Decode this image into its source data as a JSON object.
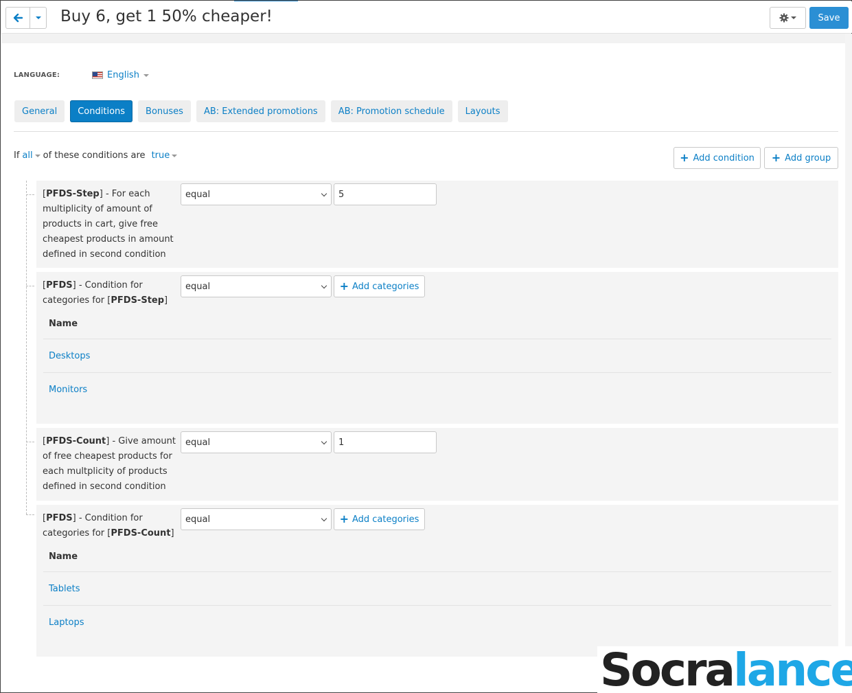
{
  "header": {
    "back_icon": "arrow-left-icon",
    "title": "Buy 6, get 1 50% cheaper!",
    "settings_icon": "gear-icon",
    "save_label": "Save"
  },
  "language": {
    "label": "LANGUAGE:",
    "value": "English"
  },
  "tabs": [
    {
      "label": "General",
      "active": false
    },
    {
      "label": "Conditions",
      "active": true
    },
    {
      "label": "Bonuses",
      "active": false
    },
    {
      "label": "AB: Extended promotions",
      "active": false
    },
    {
      "label": "AB: Promotion schedule",
      "active": false
    },
    {
      "label": "Layouts",
      "active": false
    }
  ],
  "conditions_header": {
    "if": "If",
    "all": "all",
    "of_these": "of these conditions are",
    "value": "true",
    "add_condition": "Add condition",
    "add_group": "Add group"
  },
  "conditions": [
    {
      "code": "PFDS-Step",
      "desc": " - For each multiplicity of amount of products in cart, give free cheapest products in amount defined in second condition",
      "operator": "equal",
      "value": "5"
    },
    {
      "code": "PFDS",
      "desc": " - Condition for categories for ",
      "ref": "PFDS-Step",
      "operator": "equal",
      "add_label": "Add categories",
      "table_header": "Name",
      "categories": [
        "Desktops",
        "Monitors"
      ]
    },
    {
      "code": "PFDS-Count",
      "desc": " - Give amount of free cheapest products for each multplicity of products defined in second condition",
      "operator": "equal",
      "value": "1"
    },
    {
      "code": "PFDS",
      "desc": " - Condition for categories for ",
      "ref": "PFDS-Count",
      "operator": "equal",
      "add_label": "Add categories",
      "table_header": "Name",
      "categories": [
        "Tablets",
        "Laptops"
      ]
    }
  ],
  "watermark": {
    "part1": "Socra",
    "part2": "lance"
  }
}
